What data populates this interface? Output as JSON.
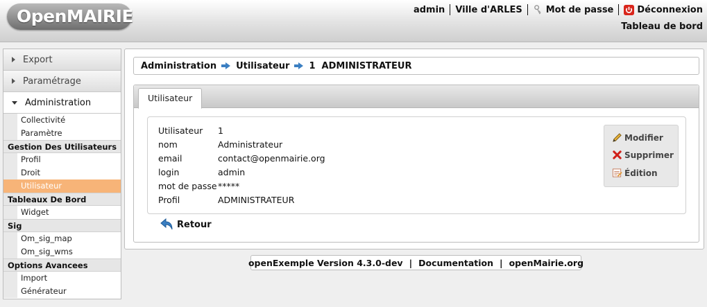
{
  "header": {
    "logo_open": "Open",
    "logo_mairie": "MAIRIE",
    "user": "admin",
    "collectivity": "Ville d'ARLES",
    "password_link": "Mot de passe",
    "logout_link": "Déconnexion",
    "dashboard_link": "Tableau de bord"
  },
  "sidebar": {
    "menus": [
      {
        "label": "Export"
      },
      {
        "label": "Paramétrage"
      },
      {
        "label": "Administration"
      }
    ],
    "admin_items": [
      "Collectivité",
      "Paramètre"
    ],
    "groups": [
      {
        "title": "Gestion Des Utilisateurs",
        "items": [
          "Profil",
          "Droit",
          "Utilisateur"
        ]
      },
      {
        "title": "Tableaux De Bord",
        "items": [
          "Widget"
        ]
      },
      {
        "title": "Sig",
        "items": [
          "Om_sig_map",
          "Om_sig_wms"
        ]
      },
      {
        "title": "Options Avancees",
        "items": [
          "Import",
          "Générateur"
        ]
      }
    ],
    "active_item": "Utilisateur"
  },
  "breadcrumb": [
    "Administration",
    "Utilisateur",
    "1  ADMINISTRATEUR"
  ],
  "tab": {
    "label": "Utilisateur"
  },
  "record": {
    "fields": [
      {
        "label": "Utilisateur",
        "value": "1"
      },
      {
        "label": "nom",
        "value": "Administrateur"
      },
      {
        "label": "email",
        "value": "contact@openmairie.org"
      },
      {
        "label": "login",
        "value": "admin"
      },
      {
        "label": "mot de passe",
        "value": "*****"
      },
      {
        "label": "Profil",
        "value": "ADMINISTRATEUR"
      }
    ]
  },
  "actions": {
    "modify": "Modifier",
    "delete": "Supprimer",
    "edition": "Édition"
  },
  "back_label": "Retour",
  "footer": {
    "version": "openExemple Version 4.3.0-dev",
    "sep": "|",
    "documentation": "Documentation",
    "site": "openMairie.org"
  },
  "colors": {
    "active_item_bg": "#f7b478",
    "breadcrumb_arrow": "#3b7fc2",
    "logout_icon": "#d9261c"
  }
}
